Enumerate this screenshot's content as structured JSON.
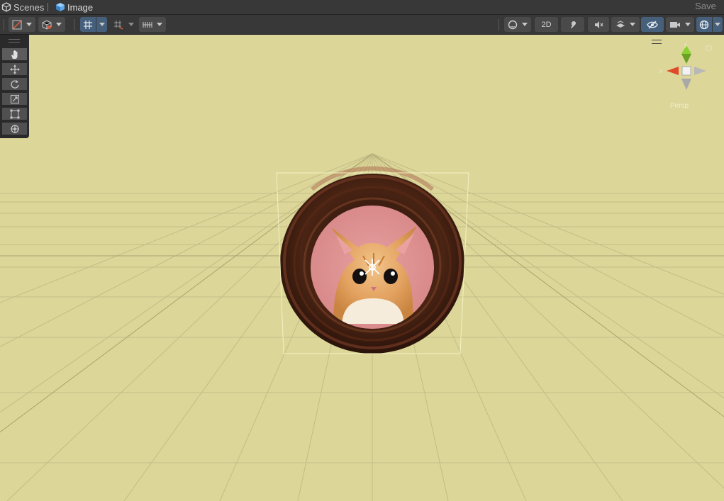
{
  "breadcrumb": {
    "root_label": "Scenes",
    "current_label": "Image",
    "save_label": "Save"
  },
  "toolbar": {
    "view_mode_2d_label": "2D"
  },
  "tool_palette": {
    "tools": [
      "hand-tool",
      "move-tool",
      "rotate-tool",
      "scale-tool",
      "rect-tool",
      "transform-tool"
    ],
    "active": "hand-tool"
  },
  "gizmo": {
    "projection_label": "Persp",
    "axis_y": "y",
    "axis_x": "x"
  },
  "colors": {
    "scene_background": "#dcd699",
    "toolbar": "#383838",
    "active_button": "#46607c",
    "selection_outline": "#f4f2c2",
    "x_axis": "#e04a2a",
    "y_axis": "#8ad030"
  }
}
